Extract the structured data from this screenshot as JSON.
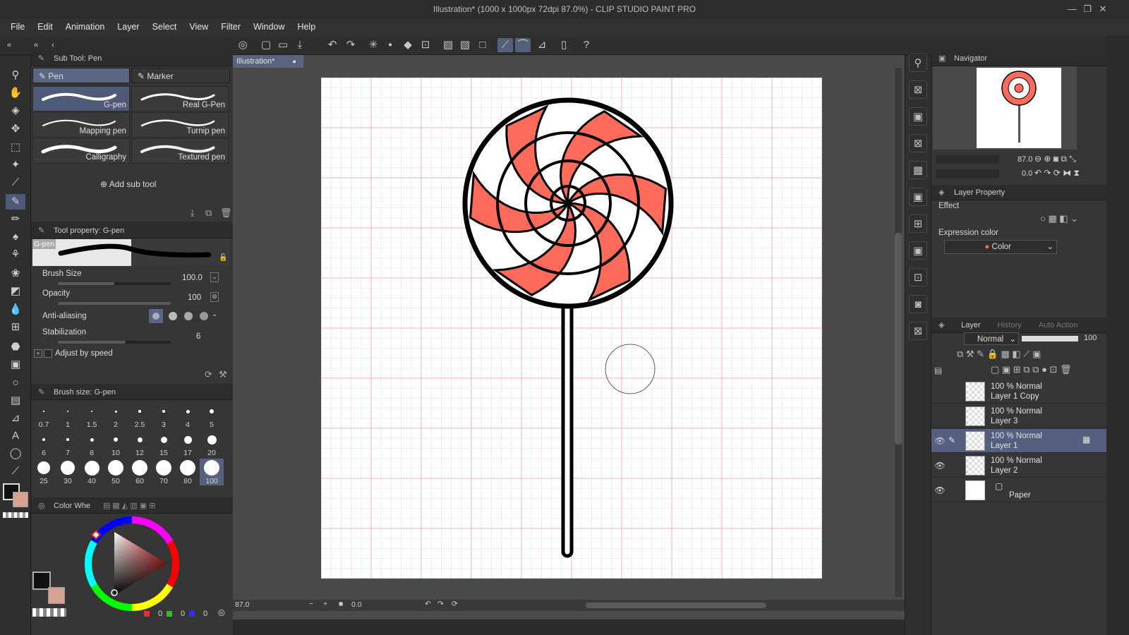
{
  "window": {
    "title": "Illustration* (1000 x 1000px 72dpi 87.0%)  - CLIP STUDIO PAINT PRO",
    "controls": [
      "—",
      "❐",
      "✕"
    ]
  },
  "menu": [
    "File",
    "Edit",
    "Animation",
    "Layer",
    "Select",
    "View",
    "Filter",
    "Window",
    "Help"
  ],
  "sub_tool": {
    "header": "Sub Tool: Pen",
    "tabs": [
      "Pen",
      "Marker"
    ],
    "brushes": [
      "G-pen",
      "Real G-Pen",
      "Mapping pen",
      "Turnip pen",
      "Calligraphy",
      "Textured pen"
    ],
    "selected_brush": "G-pen",
    "add_label": "Add sub tool"
  },
  "tool_property": {
    "header": "Tool property: G-pen",
    "preview_label": "G-pen",
    "brush_size_label": "Brush Size",
    "brush_size_value": "100.0",
    "brush_size_fraction": 0.5,
    "opacity_label": "Opacity",
    "opacity_value": "100",
    "opacity_fraction": 1.0,
    "antialiasing_label": "Anti-aliasing",
    "stabilization_label": "Stabilization",
    "stabilization_value": "6",
    "stabilization_fraction": 0.6,
    "adjust_label": "Adjust by speed"
  },
  "brush_size_panel": {
    "header": "Brush size: G-pen",
    "sizes": [
      "0.7",
      "1",
      "1.5",
      "2",
      "2.5",
      "3",
      "4",
      "5",
      "6",
      "7",
      "8",
      "10",
      "12",
      "15",
      "17",
      "20",
      "25",
      "30",
      "40",
      "50",
      "60",
      "70",
      "80",
      "100"
    ],
    "selected": "100"
  },
  "color_wheel": {
    "header": "Color Whe",
    "main_color": "#111111",
    "sub_color": "#d8a293",
    "rgb": [
      "0",
      "0",
      "0"
    ]
  },
  "canvas": {
    "doc_tab": "Illustration*",
    "zoom": "87.0",
    "rotation": "0.0",
    "grid_color": "#e8b6b6",
    "candy_red": "#ff6b5a",
    "outline": "#000000"
  },
  "navigator": {
    "header": "Navigator",
    "zoom": "87.0",
    "angle": "0.0"
  },
  "layer_property": {
    "header": "Layer Property",
    "effect_label": "Effect",
    "expression_label": "Expression color",
    "expression_value": "Color"
  },
  "layer_panel": {
    "tabs": [
      "Layer",
      "History",
      "Auto Action"
    ],
    "blend_mode": "Normal",
    "opacity": "100",
    "layers": [
      {
        "mode": "100 % Normal",
        "name": "Layer 1 Copy",
        "visible": false,
        "active": false
      },
      {
        "mode": "100 % Normal",
        "name": "Layer 3",
        "visible": false,
        "active": false
      },
      {
        "mode": "100 % Normal",
        "name": "Layer 1",
        "visible": true,
        "active": true
      },
      {
        "mode": "100 % Normal",
        "name": "Layer 2",
        "visible": true,
        "active": false
      }
    ],
    "paper_name": "Paper"
  }
}
